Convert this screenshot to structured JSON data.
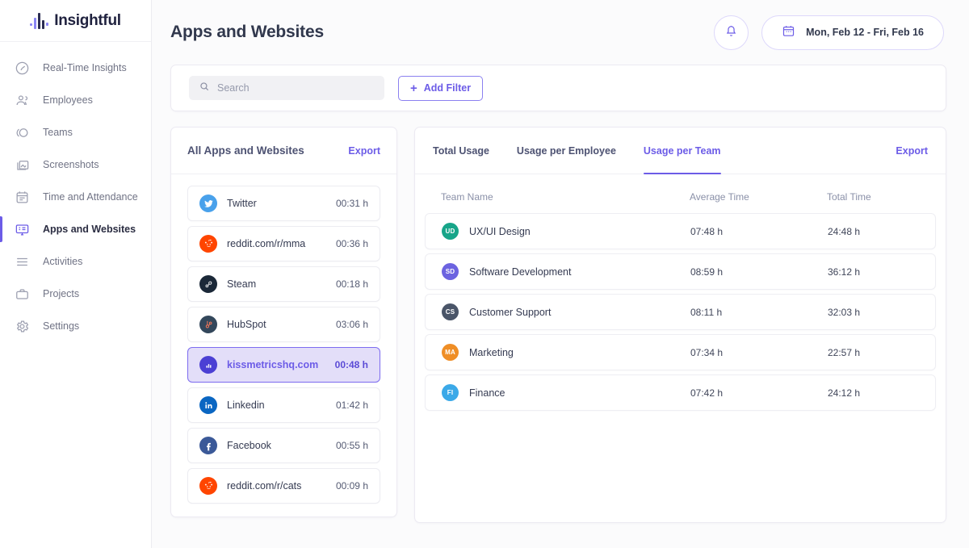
{
  "brand": {
    "name": "Insightful",
    "accent": "#6c5ce7"
  },
  "sidebar": {
    "items": [
      {
        "label": "Real-Time Insights",
        "icon": "gauge-icon",
        "active": false
      },
      {
        "label": "Employees",
        "icon": "people-icon",
        "active": false
      },
      {
        "label": "Teams",
        "icon": "teams-icon",
        "active": false
      },
      {
        "label": "Screenshots",
        "icon": "screenshots-icon",
        "active": false
      },
      {
        "label": "Time and Attendance",
        "icon": "calendar-icon",
        "active": false
      },
      {
        "label": "Apps and Websites",
        "icon": "monitor-icon",
        "active": true
      },
      {
        "label": "Activities",
        "icon": "list-icon",
        "active": false
      },
      {
        "label": "Projects",
        "icon": "briefcase-icon",
        "active": false
      },
      {
        "label": "Settings",
        "icon": "gear-icon",
        "active": false
      }
    ]
  },
  "header": {
    "title": "Apps and Websites",
    "notifications_icon": "bell-icon",
    "date_icon": "calendar-icon",
    "date_range": "Mon, Feb 12 - Fri,  Feb 16"
  },
  "filters": {
    "search_placeholder": "Search",
    "search_value": "",
    "search_icon": "search-icon",
    "add_filter_label": "Add Filter",
    "add_filter_plus": "+"
  },
  "apps_panel": {
    "title": "All Apps and Websites",
    "export_label": "Export",
    "items": [
      {
        "name": "Twitter",
        "time": "00:31 h",
        "icon": "twitter-icon",
        "bg": "#49a1eb",
        "selected": false
      },
      {
        "name": "reddit.com/r/mma",
        "time": "00:36 h",
        "icon": "reddit-icon",
        "bg": "#ff4500",
        "selected": false
      },
      {
        "name": "Steam",
        "time": "00:18 h",
        "icon": "steam-icon",
        "bg": "#1b2838",
        "selected": false
      },
      {
        "name": "HubSpot",
        "time": "03:06 h",
        "icon": "hubspot-icon",
        "bg": "#33475b",
        "selected": false
      },
      {
        "name": "kissmetricshq.com",
        "time": "00:48 h",
        "icon": "kissmetrics-icon",
        "bg": "#4b3fd4",
        "selected": true
      },
      {
        "name": "Linkedin",
        "time": "01:42 h",
        "icon": "linkedin-icon",
        "bg": "#0a66c2",
        "selected": false
      },
      {
        "name": "Facebook",
        "time": "00:55 h",
        "icon": "facebook-icon",
        "bg": "#3b5998",
        "selected": false
      },
      {
        "name": "reddit.com/r/cats",
        "time": "00:09 h",
        "icon": "reddit-icon",
        "bg": "#ff4500",
        "selected": false
      }
    ]
  },
  "usage_panel": {
    "export_label": "Export",
    "tabs": [
      {
        "label": "Total Usage",
        "active": false
      },
      {
        "label": "Usage per Employee",
        "active": false
      },
      {
        "label": "Usage per Team",
        "active": true
      }
    ],
    "columns": {
      "name": "Team Name",
      "average": "Average Time",
      "total": "Total Time"
    },
    "rows": [
      {
        "initials": "UD",
        "color": "#17a589",
        "name": "UX/UI Design",
        "average": "07:48 h",
        "total": "24:48 h"
      },
      {
        "initials": "SD",
        "color": "#6c63e0",
        "name": "Software Development",
        "average": "08:59 h",
        "total": "36:12 h"
      },
      {
        "initials": "CS",
        "color": "#4a5568",
        "name": "Customer Support",
        "average": "08:11 h",
        "total": "32:03 h"
      },
      {
        "initials": "MA",
        "color": "#ef8e26",
        "name": "Marketing",
        "average": "07:34 h",
        "total": "22:57 h"
      },
      {
        "initials": "FI",
        "color": "#3ba9e8",
        "name": "Finance",
        "average": "07:42 h",
        "total": "24:12 h"
      }
    ]
  }
}
